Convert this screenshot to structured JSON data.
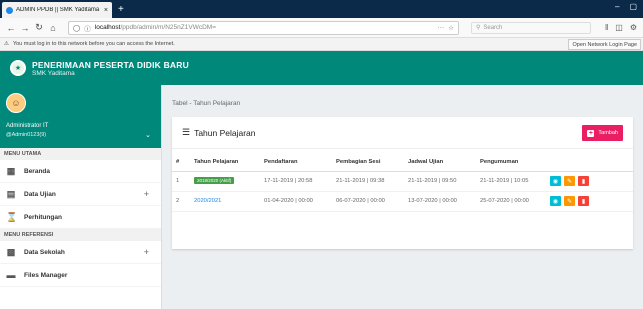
{
  "browser": {
    "tab_title": "ADMIN PPDB || SMK Yaditama",
    "tab_close": "×",
    "new_tab": "+",
    "url_host": "localhost",
    "url_path": "/ppdb/admin/m/N25nZ1VWcDM=",
    "search_placeholder": "Search",
    "window_controls": [
      "–",
      "▢"
    ],
    "notice": "You must log in to this network before you can access the Internet.",
    "notice_button": "Open Network Login Page"
  },
  "app": {
    "title": "PENERIMAAN PESERTA DIDIK BARU",
    "subtitle": "SMK Yaditama"
  },
  "sidebar": {
    "user_name": "Administrator IT",
    "user_id": "@Admin0123(9)",
    "sections": [
      {
        "label": "MENU UTAMA"
      },
      {
        "label": "MENU REFERENSI"
      }
    ],
    "items": [
      {
        "label": "Beranda",
        "icon": "dashboard-icon"
      },
      {
        "label": "Data Ujian",
        "icon": "book-icon",
        "expand": "+"
      },
      {
        "label": "Perhitungan",
        "icon": "hourglass-icon"
      },
      {
        "label": "Data Sekolah",
        "icon": "school-icon",
        "expand": "+"
      },
      {
        "label": "Files Manager",
        "icon": "folder-icon"
      }
    ]
  },
  "main": {
    "breadcrumb": "Tabel - Tahun Pelajaran",
    "card_title": "Tahun Pelajaran",
    "add_button": "Tambah",
    "table": {
      "headers": [
        "#",
        "Tahun Pelajaran",
        "Pendaftaran",
        "Pembagian Sesi",
        "Jadwal Ujian",
        "Pengumuman"
      ],
      "rows": [
        {
          "no": "1",
          "tahun": "2019/2020 (Aktif)",
          "pendaftaran": "17-11-2019 | 20:58",
          "sesi": "21-11-2019 | 09:38",
          "ujian": "21-11-2019 | 09:50",
          "pengumuman": "21-11-2019 | 10:05"
        },
        {
          "no": "2",
          "tahun": "2020/2021",
          "pendaftaran": "01-04-2020 | 00:00",
          "sesi": "06-07-2020 | 00:00",
          "ujian": "13-07-2020 | 00:00",
          "pengumuman": "25-07-2020 | 00:00"
        }
      ]
    }
  },
  "colors": {
    "primary": "#00897b",
    "accent": "#e91e63",
    "view": "#00bcd4",
    "edit": "#ff9800",
    "delete": "#f44336"
  }
}
